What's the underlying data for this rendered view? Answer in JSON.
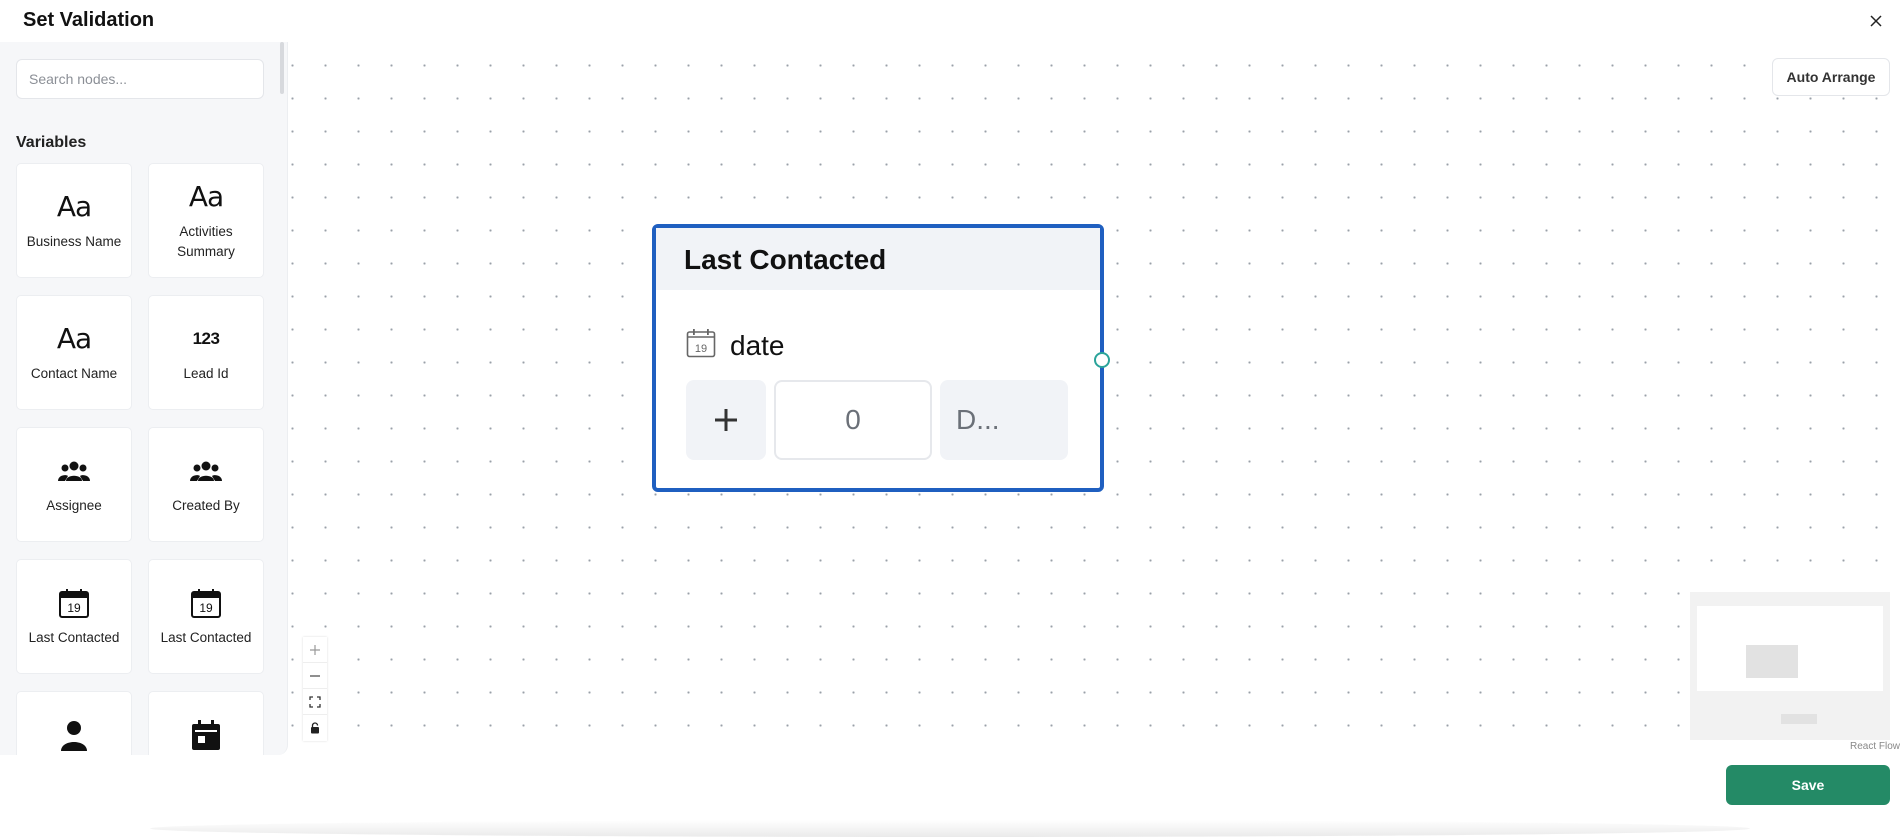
{
  "dialog": {
    "title": "Set Validation"
  },
  "sidebar": {
    "search_placeholder": "Search nodes...",
    "section_label": "Variables",
    "items": [
      {
        "label": "Business Name",
        "icon": "text-aa-icon"
      },
      {
        "label": "Activities Summary",
        "icon": "text-aa-icon"
      },
      {
        "label": "Contact Name",
        "icon": "text-aa-icon"
      },
      {
        "label": "Lead Id",
        "icon": "number-123-icon"
      },
      {
        "label": "Assignee",
        "icon": "users-group-icon"
      },
      {
        "label": "Created By",
        "icon": "users-group-icon"
      },
      {
        "label": "Last Contacted",
        "icon": "calendar-19-icon"
      },
      {
        "label": "Last Contacted",
        "icon": "calendar-19-icon"
      },
      {
        "label": "",
        "icon": "person-icon"
      },
      {
        "label": "",
        "icon": "calendar-event-icon"
      }
    ],
    "text_glyph": "Aa",
    "number_glyph": "123",
    "calendar_day": "19"
  },
  "canvas": {
    "auto_arrange_label": "Auto Arrange",
    "attribution": "React Flow",
    "node": {
      "title": "Last Contacted",
      "type_label": "date",
      "calendar_day": "19",
      "offset_value": "0",
      "unit_label": "D..."
    }
  },
  "footer": {
    "save_label": "Save"
  },
  "colors": {
    "node_border": "#1f5fc0",
    "handle": "#2aa39a",
    "save": "#248a66"
  }
}
